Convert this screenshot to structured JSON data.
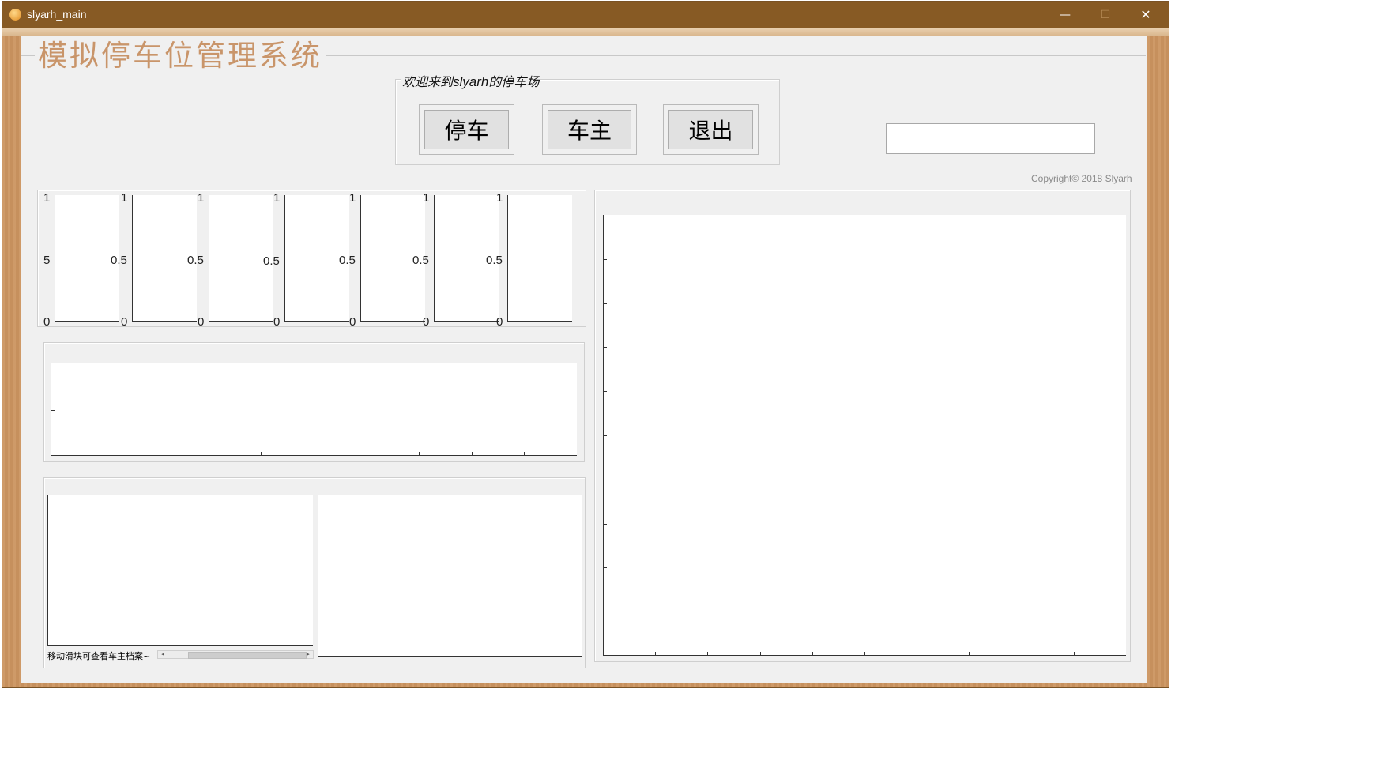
{
  "window": {
    "title": "slyarh_main",
    "minimize_glyph": "—",
    "maximize_glyph": "☐",
    "close_glyph": "✕"
  },
  "header": {
    "system_title": "模拟停车位管理系统"
  },
  "welcome_panel": {
    "legend_prefix": "欢迎来到",
    "legend_name": "slyarh",
    "legend_suffix": "的停车场"
  },
  "buttons": {
    "park": "停车",
    "owner": "车主",
    "exit": "退出"
  },
  "search_field": {
    "value": ""
  },
  "copyright": "Copyright© 2018 Slyarh",
  "mini_axes": {
    "top_tick": "1",
    "mid_tick": "0.5",
    "mid_tick_clipped": "5",
    "zero_tick": "0"
  },
  "owner_archive": {
    "scroll_hint": "移动滑块可查看车主档案~",
    "scroll_left": "◂",
    "scroll_right": "▸"
  },
  "icons": {
    "app": "app-icon",
    "minimize": "minimize-icon",
    "maximize": "maximize-icon",
    "close": "close-icon"
  }
}
